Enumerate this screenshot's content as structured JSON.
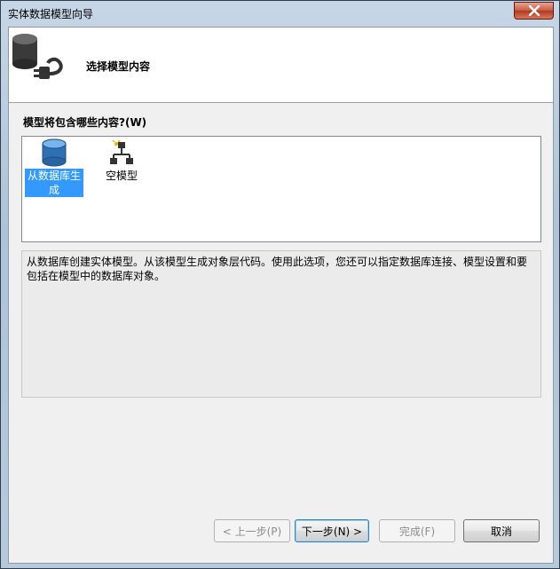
{
  "window": {
    "title": "实体数据模型向导"
  },
  "header": {
    "title": "选择模型内容"
  },
  "question": {
    "label": "模型将包含哪些内容?(W)"
  },
  "options": [
    {
      "label": "从数据库生成",
      "selected": true
    },
    {
      "label": "空模型",
      "selected": false
    }
  ],
  "description": {
    "text": "从数据库创建实体模型。从该模型生成对象层代码。使用此选项，您还可以指定数据库连接、模型设置和要包括在模型中的数据库对象。"
  },
  "buttons": {
    "back": "< 上一步(P)",
    "next": "下一步(N) >",
    "finish": "完成(F)",
    "cancel": "取消"
  },
  "colors": {
    "selection": "#3399ff",
    "close_button": "#c75a40"
  }
}
